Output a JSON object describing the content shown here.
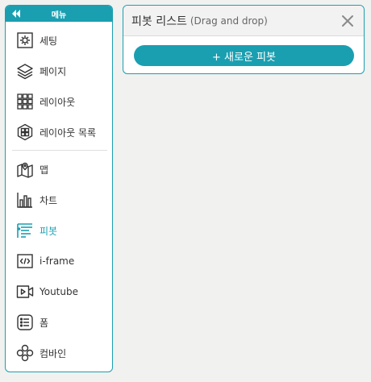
{
  "sidebar": {
    "title": "메뉴",
    "items": [
      {
        "label": "세팅",
        "icon": "gear-icon"
      },
      {
        "label": "페이지",
        "icon": "layers-icon"
      },
      {
        "label": "레이아웃",
        "icon": "grid-icon"
      },
      {
        "label": "레이아웃 목록",
        "icon": "layout-list-icon"
      },
      {
        "label": "맵",
        "icon": "map-icon"
      },
      {
        "label": "차트",
        "icon": "bar-chart-icon"
      },
      {
        "label": "피봇",
        "icon": "pivot-icon"
      },
      {
        "label": "i-frame",
        "icon": "code-icon"
      },
      {
        "label": "Youtube",
        "icon": "video-icon"
      },
      {
        "label": "폼",
        "icon": "form-list-icon"
      },
      {
        "label": "컴바인",
        "icon": "combine-icon"
      }
    ],
    "active_item": "피봇"
  },
  "panel": {
    "title": "피봇 리스트",
    "subtitle": "(Drag and drop)",
    "add_button": "+ 새로운 피봇"
  },
  "colors": {
    "accent": "#1a9fb1",
    "background": "#f1f1f0"
  }
}
